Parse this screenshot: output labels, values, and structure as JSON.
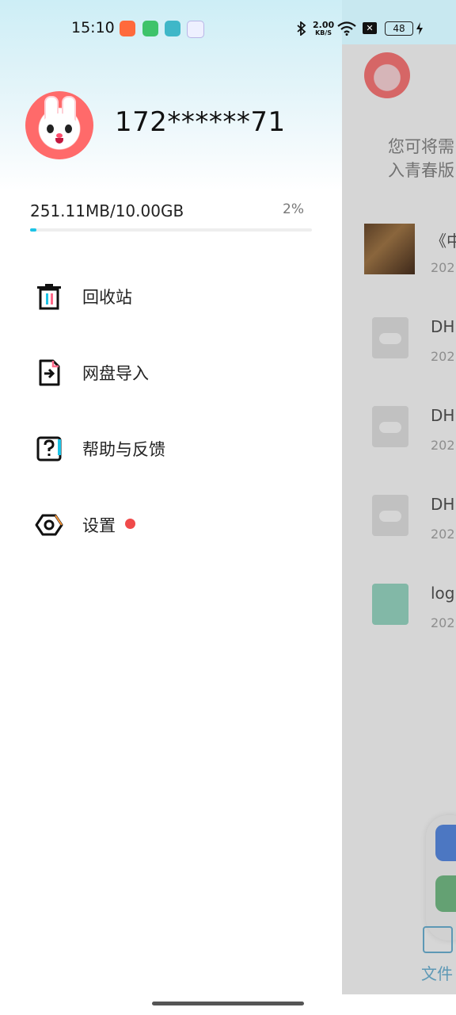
{
  "status_bar": {
    "time": "15:10",
    "net_speed_value": "2.00",
    "net_speed_unit": "KB/S",
    "battery": "48",
    "icons": [
      "app-icon-red",
      "app-icon-green",
      "app-icon-teal",
      "app-icon-purple",
      "bluetooth-icon",
      "wifi-icon",
      "x-icon",
      "charging-icon"
    ]
  },
  "drawer": {
    "username": "172******71",
    "storage": {
      "used_total": "251.11MB/10.00GB",
      "percent_label": "2%",
      "percent": 0.02,
      "accent": "#1cc3e6"
    },
    "menu": [
      {
        "label": "回收站",
        "icon": "trash-icon"
      },
      {
        "label": "网盘导入",
        "icon": "file-import-icon"
      },
      {
        "label": "帮助与反馈",
        "icon": "help-icon"
      },
      {
        "label": "设置",
        "icon": "settings-hex-icon",
        "badge": true
      }
    ],
    "badge_color": "#f04a4a"
  },
  "background_app": {
    "hint_line1": "您可将需",
    "hint_line2": "入青春版",
    "files": [
      {
        "name": "《中",
        "date": "202"
      },
      {
        "name": "DH",
        "date": "202"
      },
      {
        "name": "DH",
        "date": "202"
      },
      {
        "name": "DH",
        "date": "202"
      },
      {
        "name": "log",
        "date": "202"
      }
    ],
    "tab_label": "文件"
  }
}
